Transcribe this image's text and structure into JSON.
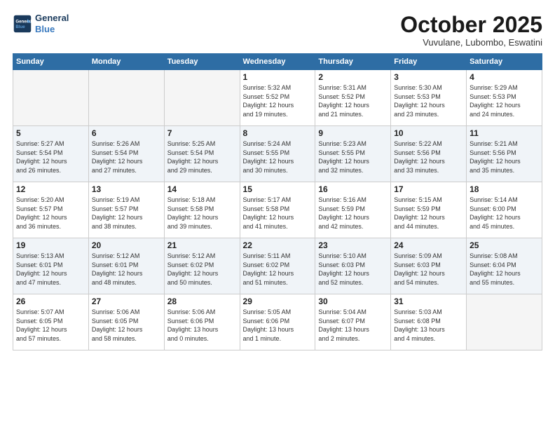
{
  "logo": {
    "line1": "General",
    "line2": "Blue"
  },
  "title": "October 2025",
  "location": "Vuvulane, Lubombo, Eswatini",
  "weekdays": [
    "Sunday",
    "Monday",
    "Tuesday",
    "Wednesday",
    "Thursday",
    "Friday",
    "Saturday"
  ],
  "weeks": [
    [
      {
        "day": "",
        "info": ""
      },
      {
        "day": "",
        "info": ""
      },
      {
        "day": "",
        "info": ""
      },
      {
        "day": "1",
        "info": "Sunrise: 5:32 AM\nSunset: 5:52 PM\nDaylight: 12 hours\nand 19 minutes."
      },
      {
        "day": "2",
        "info": "Sunrise: 5:31 AM\nSunset: 5:52 PM\nDaylight: 12 hours\nand 21 minutes."
      },
      {
        "day": "3",
        "info": "Sunrise: 5:30 AM\nSunset: 5:53 PM\nDaylight: 12 hours\nand 23 minutes."
      },
      {
        "day": "4",
        "info": "Sunrise: 5:29 AM\nSunset: 5:53 PM\nDaylight: 12 hours\nand 24 minutes."
      }
    ],
    [
      {
        "day": "5",
        "info": "Sunrise: 5:27 AM\nSunset: 5:54 PM\nDaylight: 12 hours\nand 26 minutes."
      },
      {
        "day": "6",
        "info": "Sunrise: 5:26 AM\nSunset: 5:54 PM\nDaylight: 12 hours\nand 27 minutes."
      },
      {
        "day": "7",
        "info": "Sunrise: 5:25 AM\nSunset: 5:54 PM\nDaylight: 12 hours\nand 29 minutes."
      },
      {
        "day": "8",
        "info": "Sunrise: 5:24 AM\nSunset: 5:55 PM\nDaylight: 12 hours\nand 30 minutes."
      },
      {
        "day": "9",
        "info": "Sunrise: 5:23 AM\nSunset: 5:55 PM\nDaylight: 12 hours\nand 32 minutes."
      },
      {
        "day": "10",
        "info": "Sunrise: 5:22 AM\nSunset: 5:56 PM\nDaylight: 12 hours\nand 33 minutes."
      },
      {
        "day": "11",
        "info": "Sunrise: 5:21 AM\nSunset: 5:56 PM\nDaylight: 12 hours\nand 35 minutes."
      }
    ],
    [
      {
        "day": "12",
        "info": "Sunrise: 5:20 AM\nSunset: 5:57 PM\nDaylight: 12 hours\nand 36 minutes."
      },
      {
        "day": "13",
        "info": "Sunrise: 5:19 AM\nSunset: 5:57 PM\nDaylight: 12 hours\nand 38 minutes."
      },
      {
        "day": "14",
        "info": "Sunrise: 5:18 AM\nSunset: 5:58 PM\nDaylight: 12 hours\nand 39 minutes."
      },
      {
        "day": "15",
        "info": "Sunrise: 5:17 AM\nSunset: 5:58 PM\nDaylight: 12 hours\nand 41 minutes."
      },
      {
        "day": "16",
        "info": "Sunrise: 5:16 AM\nSunset: 5:59 PM\nDaylight: 12 hours\nand 42 minutes."
      },
      {
        "day": "17",
        "info": "Sunrise: 5:15 AM\nSunset: 5:59 PM\nDaylight: 12 hours\nand 44 minutes."
      },
      {
        "day": "18",
        "info": "Sunrise: 5:14 AM\nSunset: 6:00 PM\nDaylight: 12 hours\nand 45 minutes."
      }
    ],
    [
      {
        "day": "19",
        "info": "Sunrise: 5:13 AM\nSunset: 6:01 PM\nDaylight: 12 hours\nand 47 minutes."
      },
      {
        "day": "20",
        "info": "Sunrise: 5:12 AM\nSunset: 6:01 PM\nDaylight: 12 hours\nand 48 minutes."
      },
      {
        "day": "21",
        "info": "Sunrise: 5:12 AM\nSunset: 6:02 PM\nDaylight: 12 hours\nand 50 minutes."
      },
      {
        "day": "22",
        "info": "Sunrise: 5:11 AM\nSunset: 6:02 PM\nDaylight: 12 hours\nand 51 minutes."
      },
      {
        "day": "23",
        "info": "Sunrise: 5:10 AM\nSunset: 6:03 PM\nDaylight: 12 hours\nand 52 minutes."
      },
      {
        "day": "24",
        "info": "Sunrise: 5:09 AM\nSunset: 6:03 PM\nDaylight: 12 hours\nand 54 minutes."
      },
      {
        "day": "25",
        "info": "Sunrise: 5:08 AM\nSunset: 6:04 PM\nDaylight: 12 hours\nand 55 minutes."
      }
    ],
    [
      {
        "day": "26",
        "info": "Sunrise: 5:07 AM\nSunset: 6:05 PM\nDaylight: 12 hours\nand 57 minutes."
      },
      {
        "day": "27",
        "info": "Sunrise: 5:06 AM\nSunset: 6:05 PM\nDaylight: 12 hours\nand 58 minutes."
      },
      {
        "day": "28",
        "info": "Sunrise: 5:06 AM\nSunset: 6:06 PM\nDaylight: 13 hours\nand 0 minutes."
      },
      {
        "day": "29",
        "info": "Sunrise: 5:05 AM\nSunset: 6:06 PM\nDaylight: 13 hours\nand 1 minute."
      },
      {
        "day": "30",
        "info": "Sunrise: 5:04 AM\nSunset: 6:07 PM\nDaylight: 13 hours\nand 2 minutes."
      },
      {
        "day": "31",
        "info": "Sunrise: 5:03 AM\nSunset: 6:08 PM\nDaylight: 13 hours\nand 4 minutes."
      },
      {
        "day": "",
        "info": ""
      }
    ]
  ]
}
